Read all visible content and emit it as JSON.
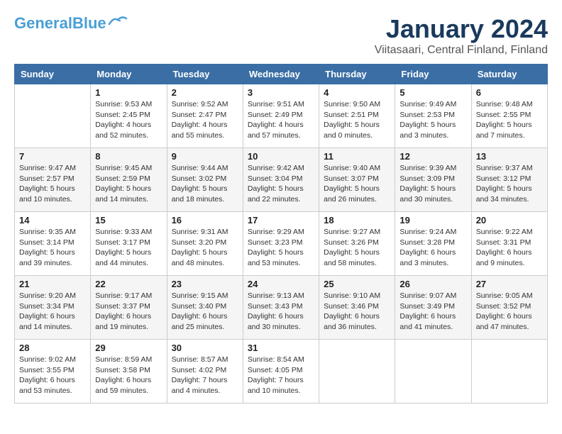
{
  "header": {
    "logo_general": "General",
    "logo_blue": "Blue",
    "title": "January 2024",
    "subtitle": "Viitasaari, Central Finland, Finland"
  },
  "calendar": {
    "days_of_week": [
      "Sunday",
      "Monday",
      "Tuesday",
      "Wednesday",
      "Thursday",
      "Friday",
      "Saturday"
    ],
    "weeks": [
      [
        {
          "day": "",
          "info": ""
        },
        {
          "day": "1",
          "info": "Sunrise: 9:53 AM\nSunset: 2:45 PM\nDaylight: 4 hours\nand 52 minutes."
        },
        {
          "day": "2",
          "info": "Sunrise: 9:52 AM\nSunset: 2:47 PM\nDaylight: 4 hours\nand 55 minutes."
        },
        {
          "day": "3",
          "info": "Sunrise: 9:51 AM\nSunset: 2:49 PM\nDaylight: 4 hours\nand 57 minutes."
        },
        {
          "day": "4",
          "info": "Sunrise: 9:50 AM\nSunset: 2:51 PM\nDaylight: 5 hours\nand 0 minutes."
        },
        {
          "day": "5",
          "info": "Sunrise: 9:49 AM\nSunset: 2:53 PM\nDaylight: 5 hours\nand 3 minutes."
        },
        {
          "day": "6",
          "info": "Sunrise: 9:48 AM\nSunset: 2:55 PM\nDaylight: 5 hours\nand 7 minutes."
        }
      ],
      [
        {
          "day": "7",
          "info": "Sunrise: 9:47 AM\nSunset: 2:57 PM\nDaylight: 5 hours\nand 10 minutes."
        },
        {
          "day": "8",
          "info": "Sunrise: 9:45 AM\nSunset: 2:59 PM\nDaylight: 5 hours\nand 14 minutes."
        },
        {
          "day": "9",
          "info": "Sunrise: 9:44 AM\nSunset: 3:02 PM\nDaylight: 5 hours\nand 18 minutes."
        },
        {
          "day": "10",
          "info": "Sunrise: 9:42 AM\nSunset: 3:04 PM\nDaylight: 5 hours\nand 22 minutes."
        },
        {
          "day": "11",
          "info": "Sunrise: 9:40 AM\nSunset: 3:07 PM\nDaylight: 5 hours\nand 26 minutes."
        },
        {
          "day": "12",
          "info": "Sunrise: 9:39 AM\nSunset: 3:09 PM\nDaylight: 5 hours\nand 30 minutes."
        },
        {
          "day": "13",
          "info": "Sunrise: 9:37 AM\nSunset: 3:12 PM\nDaylight: 5 hours\nand 34 minutes."
        }
      ],
      [
        {
          "day": "14",
          "info": "Sunrise: 9:35 AM\nSunset: 3:14 PM\nDaylight: 5 hours\nand 39 minutes."
        },
        {
          "day": "15",
          "info": "Sunrise: 9:33 AM\nSunset: 3:17 PM\nDaylight: 5 hours\nand 44 minutes."
        },
        {
          "day": "16",
          "info": "Sunrise: 9:31 AM\nSunset: 3:20 PM\nDaylight: 5 hours\nand 48 minutes."
        },
        {
          "day": "17",
          "info": "Sunrise: 9:29 AM\nSunset: 3:23 PM\nDaylight: 5 hours\nand 53 minutes."
        },
        {
          "day": "18",
          "info": "Sunrise: 9:27 AM\nSunset: 3:26 PM\nDaylight: 5 hours\nand 58 minutes."
        },
        {
          "day": "19",
          "info": "Sunrise: 9:24 AM\nSunset: 3:28 PM\nDaylight: 6 hours\nand 3 minutes."
        },
        {
          "day": "20",
          "info": "Sunrise: 9:22 AM\nSunset: 3:31 PM\nDaylight: 6 hours\nand 9 minutes."
        }
      ],
      [
        {
          "day": "21",
          "info": "Sunrise: 9:20 AM\nSunset: 3:34 PM\nDaylight: 6 hours\nand 14 minutes."
        },
        {
          "day": "22",
          "info": "Sunrise: 9:17 AM\nSunset: 3:37 PM\nDaylight: 6 hours\nand 19 minutes."
        },
        {
          "day": "23",
          "info": "Sunrise: 9:15 AM\nSunset: 3:40 PM\nDaylight: 6 hours\nand 25 minutes."
        },
        {
          "day": "24",
          "info": "Sunrise: 9:13 AM\nSunset: 3:43 PM\nDaylight: 6 hours\nand 30 minutes."
        },
        {
          "day": "25",
          "info": "Sunrise: 9:10 AM\nSunset: 3:46 PM\nDaylight: 6 hours\nand 36 minutes."
        },
        {
          "day": "26",
          "info": "Sunrise: 9:07 AM\nSunset: 3:49 PM\nDaylight: 6 hours\nand 41 minutes."
        },
        {
          "day": "27",
          "info": "Sunrise: 9:05 AM\nSunset: 3:52 PM\nDaylight: 6 hours\nand 47 minutes."
        }
      ],
      [
        {
          "day": "28",
          "info": "Sunrise: 9:02 AM\nSunset: 3:55 PM\nDaylight: 6 hours\nand 53 minutes."
        },
        {
          "day": "29",
          "info": "Sunrise: 8:59 AM\nSunset: 3:58 PM\nDaylight: 6 hours\nand 59 minutes."
        },
        {
          "day": "30",
          "info": "Sunrise: 8:57 AM\nSunset: 4:02 PM\nDaylight: 7 hours\nand 4 minutes."
        },
        {
          "day": "31",
          "info": "Sunrise: 8:54 AM\nSunset: 4:05 PM\nDaylight: 7 hours\nand 10 minutes."
        },
        {
          "day": "",
          "info": ""
        },
        {
          "day": "",
          "info": ""
        },
        {
          "day": "",
          "info": ""
        }
      ]
    ]
  }
}
